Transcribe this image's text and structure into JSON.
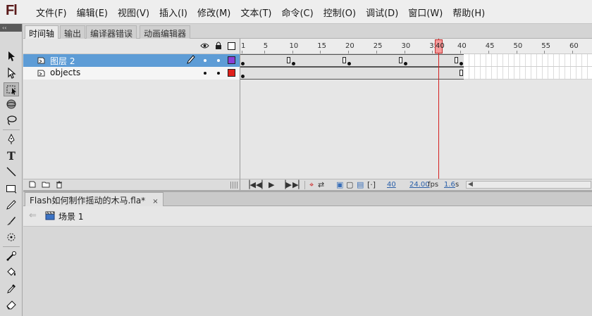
{
  "app": {
    "logo": "Fl"
  },
  "menu": [
    "文件(F)",
    "编辑(E)",
    "视图(V)",
    "插入(I)",
    "修改(M)",
    "文本(T)",
    "命令(C)",
    "控制(O)",
    "调试(D)",
    "窗口(W)",
    "帮助(H)"
  ],
  "panel_tabs": [
    "时间轴",
    "输出",
    "编译器错误",
    "动画编辑器"
  ],
  "timeline": {
    "ruler_labels": [
      "1",
      "5",
      "10",
      "15",
      "20",
      "25",
      "30",
      "35",
      "40",
      "45",
      "50",
      "55",
      "60"
    ],
    "current_frame_marker": "40",
    "layers": [
      {
        "name": "图层 2",
        "selected": true,
        "color": "#8b3fd6"
      },
      {
        "name": "objects",
        "selected": false,
        "color": "#e0201a"
      }
    ],
    "keyframes": [
      1,
      10,
      20,
      30,
      40
    ],
    "tween_end_frame": 40
  },
  "controls": {
    "current_frame": "40",
    "fps_value": "24.00",
    "fps_unit": "fps",
    "time_value": "1.6",
    "time_unit": "s"
  },
  "document": {
    "tab_title": "Flash如何制作摇动的木马.fla*",
    "tab_close": "×",
    "scene_label": "场景 1"
  },
  "colors": {
    "selection": "#5d9cd6",
    "playhead": "#d42020"
  }
}
